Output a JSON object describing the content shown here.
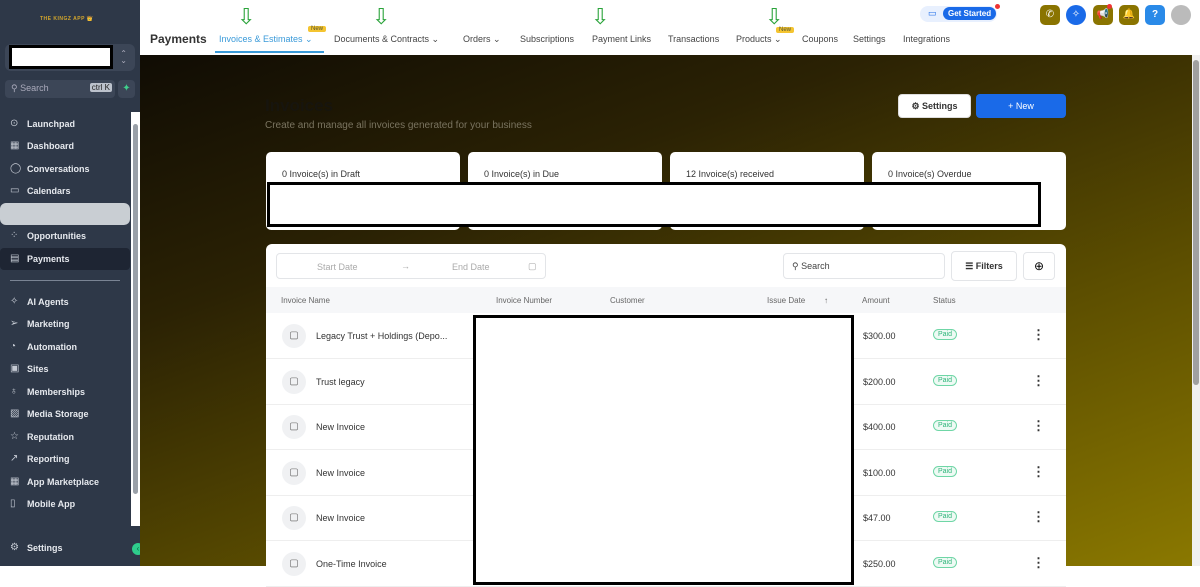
{
  "brand": "THE KINGZ APP",
  "sidebar": {
    "search_placeholder": "Search",
    "search_shortcut": "ctrl K",
    "items": [
      {
        "label": "Launchpad",
        "icon": "rocket-icon"
      },
      {
        "label": "Dashboard",
        "icon": "grid-icon"
      },
      {
        "label": "Conversations",
        "icon": "chat-icon"
      },
      {
        "label": "Calendars",
        "icon": "calendar-icon"
      },
      {
        "label": "",
        "icon": ""
      },
      {
        "label": "Opportunities",
        "icon": "funnel-icon"
      },
      {
        "label": "Payments",
        "icon": "receipt-icon"
      }
    ],
    "items2": [
      {
        "label": "AI Agents"
      },
      {
        "label": "Marketing"
      },
      {
        "label": "Automation"
      },
      {
        "label": "Sites"
      },
      {
        "label": "Memberships"
      },
      {
        "label": "Media Storage"
      },
      {
        "label": "Reputation"
      },
      {
        "label": "Reporting"
      },
      {
        "label": "App Marketplace"
      },
      {
        "label": "Mobile App"
      }
    ],
    "settings": "Settings"
  },
  "topbar": {
    "title": "Payments",
    "tabs": [
      "Invoices & Estimates",
      "Documents & Contracts",
      "Orders",
      "Subscriptions",
      "Payment Links",
      "Transactions",
      "Products",
      "Coupons",
      "Settings",
      "Integrations"
    ],
    "new_badge": "New",
    "get_started": "Get Started"
  },
  "page": {
    "title": "Invoices",
    "subtitle": "Create and manage all invoices generated for your business",
    "settings": "Settings",
    "new": "+ New"
  },
  "stats": [
    "0 Invoice(s) in Draft",
    "0 Invoice(s) in Due",
    "12 Invoice(s) received",
    "0 Invoice(s) Overdue"
  ],
  "table": {
    "start_date": "Start Date",
    "end_date": "End Date",
    "search": "Search",
    "filters": "Filters",
    "headers": [
      "Invoice Name",
      "Invoice Number",
      "Customer",
      "Issue Date",
      "Amount",
      "Status"
    ],
    "rows": [
      {
        "name": "Legacy Trust + Holdings (Depo...",
        "amount": "$300.00",
        "status": "Paid"
      },
      {
        "name": "Trust legacy",
        "amount": "$200.00",
        "status": "Paid"
      },
      {
        "name": "New Invoice",
        "amount": "$400.00",
        "status": "Paid"
      },
      {
        "name": "New Invoice",
        "amount": "$100.00",
        "status": "Paid"
      },
      {
        "name": "New Invoice",
        "amount": "$47.00",
        "status": "Paid"
      },
      {
        "name": "One-Time Invoice",
        "amount": "$250.00",
        "status": "Paid"
      }
    ]
  }
}
